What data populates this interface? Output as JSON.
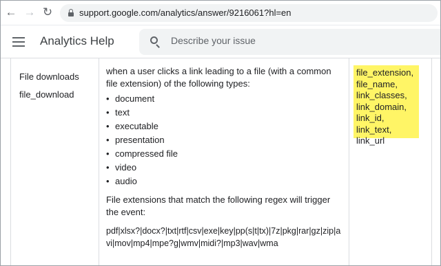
{
  "browser": {
    "url": "support.google.com/analytics/answer/9216061?hl=en"
  },
  "header": {
    "title": "Analytics Help",
    "search_placeholder": "Describe your issue"
  },
  "row": {
    "event_label": "File downloads",
    "event_name": "file_download",
    "description": {
      "intro": "when a user clicks a link leading to a file (with a common file extension) of the following types:",
      "file_types": [
        "document",
        "text",
        "executable",
        "presentation",
        "compressed file",
        "video",
        "audio"
      ],
      "regex_intro": "File extensions that match the following regex will trigger the event:",
      "regex": "pdf|xlsx?|docx?|txt|rtf|csv|exe|key|pp(s|t|tx)|7z|pkg|rar|gz|zip|avi|mov|mp4|mpe?g|wmv|midi?|mp3|wav|wma"
    },
    "parameters": "file_extension, file_name, link_classes, link_domain, link_id, link_text, link_url"
  },
  "colors": {
    "highlight": "#fff566",
    "table_border": "#dadce0",
    "search_bg": "#f1f3f4"
  }
}
